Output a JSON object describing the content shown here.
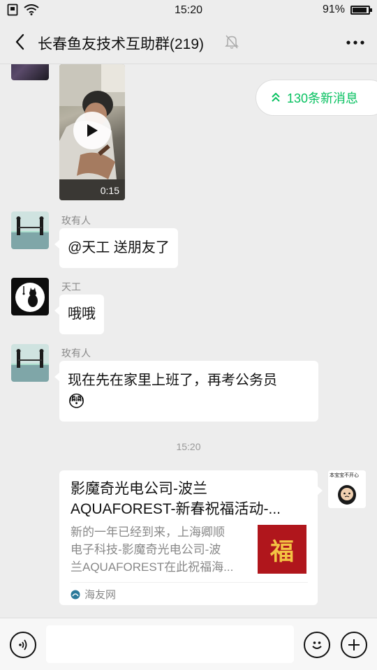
{
  "status_bar": {
    "time": "15:20",
    "battery": "91%",
    "battery_level": 0.91
  },
  "header": {
    "title": "长春鱼友技术互助群(219)"
  },
  "new_messages": {
    "label": "130条新消息"
  },
  "video": {
    "duration": "0:15"
  },
  "messages": [
    {
      "sender": "玫有人",
      "text": "@天工  送朋友了"
    },
    {
      "sender": "天工",
      "text": "哦哦"
    },
    {
      "sender": "玫有人",
      "text": "现在先在家里上班了，再考公务员",
      "emoji": "😳"
    }
  ],
  "timestamp": "15:20",
  "link_card": {
    "title_line1": "影魔奇光电公司-波兰",
    "title_line2": "AQUAFOREST-新春祝福活动-...",
    "desc_line1": "新的一年已经到来，上海卿顺",
    "desc_line2": "电子科技-影魔奇光电公司-波",
    "desc_line3": "兰AQUAFOREST在此祝福海...",
    "thumb_text": "福",
    "source": "海友网"
  },
  "sticker_avatar_text": "本宝宝不开心",
  "input": {
    "placeholder": ""
  }
}
